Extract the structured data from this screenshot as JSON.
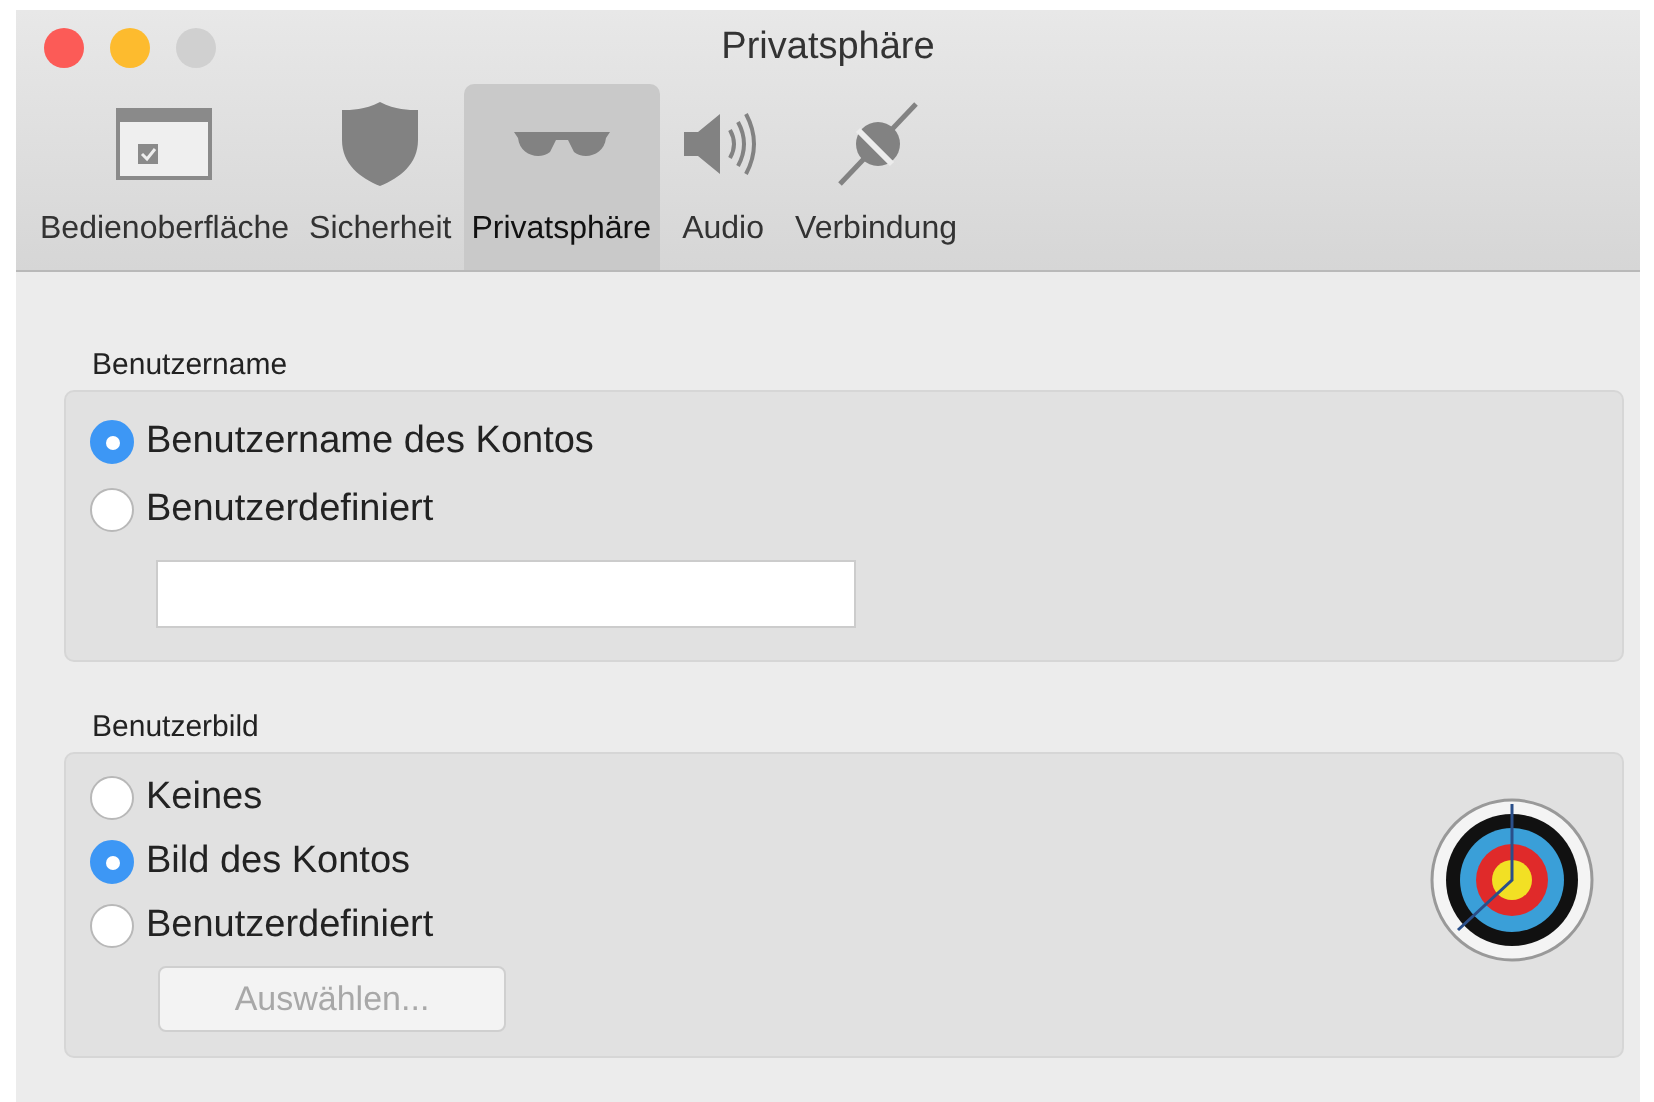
{
  "window": {
    "title": "Privatsphäre"
  },
  "tabs": [
    {
      "label": "Bedienoberfläche",
      "kind": "interface",
      "selected": false
    },
    {
      "label": "Sicherheit",
      "kind": "security",
      "selected": false
    },
    {
      "label": "Privatsphäre",
      "kind": "privacy",
      "selected": true
    },
    {
      "label": "Audio",
      "kind": "audio",
      "selected": false
    },
    {
      "label": "Verbindung",
      "kind": "connection",
      "selected": false
    }
  ],
  "username": {
    "heading": "Benutzername",
    "options": [
      {
        "label": "Benutzername des Kontos",
        "selected": true
      },
      {
        "label": "Benutzerdefiniert",
        "selected": false
      }
    ]
  },
  "avatar": {
    "heading": "Benutzerbild",
    "options": [
      {
        "label": "Keines",
        "selected": false
      },
      {
        "label": "Bild des Kontos",
        "selected": true
      },
      {
        "label": "Benutzerdefiniert",
        "selected": false
      }
    ],
    "choose_button": {
      "label": "Auswählen...",
      "disabled": true
    }
  }
}
